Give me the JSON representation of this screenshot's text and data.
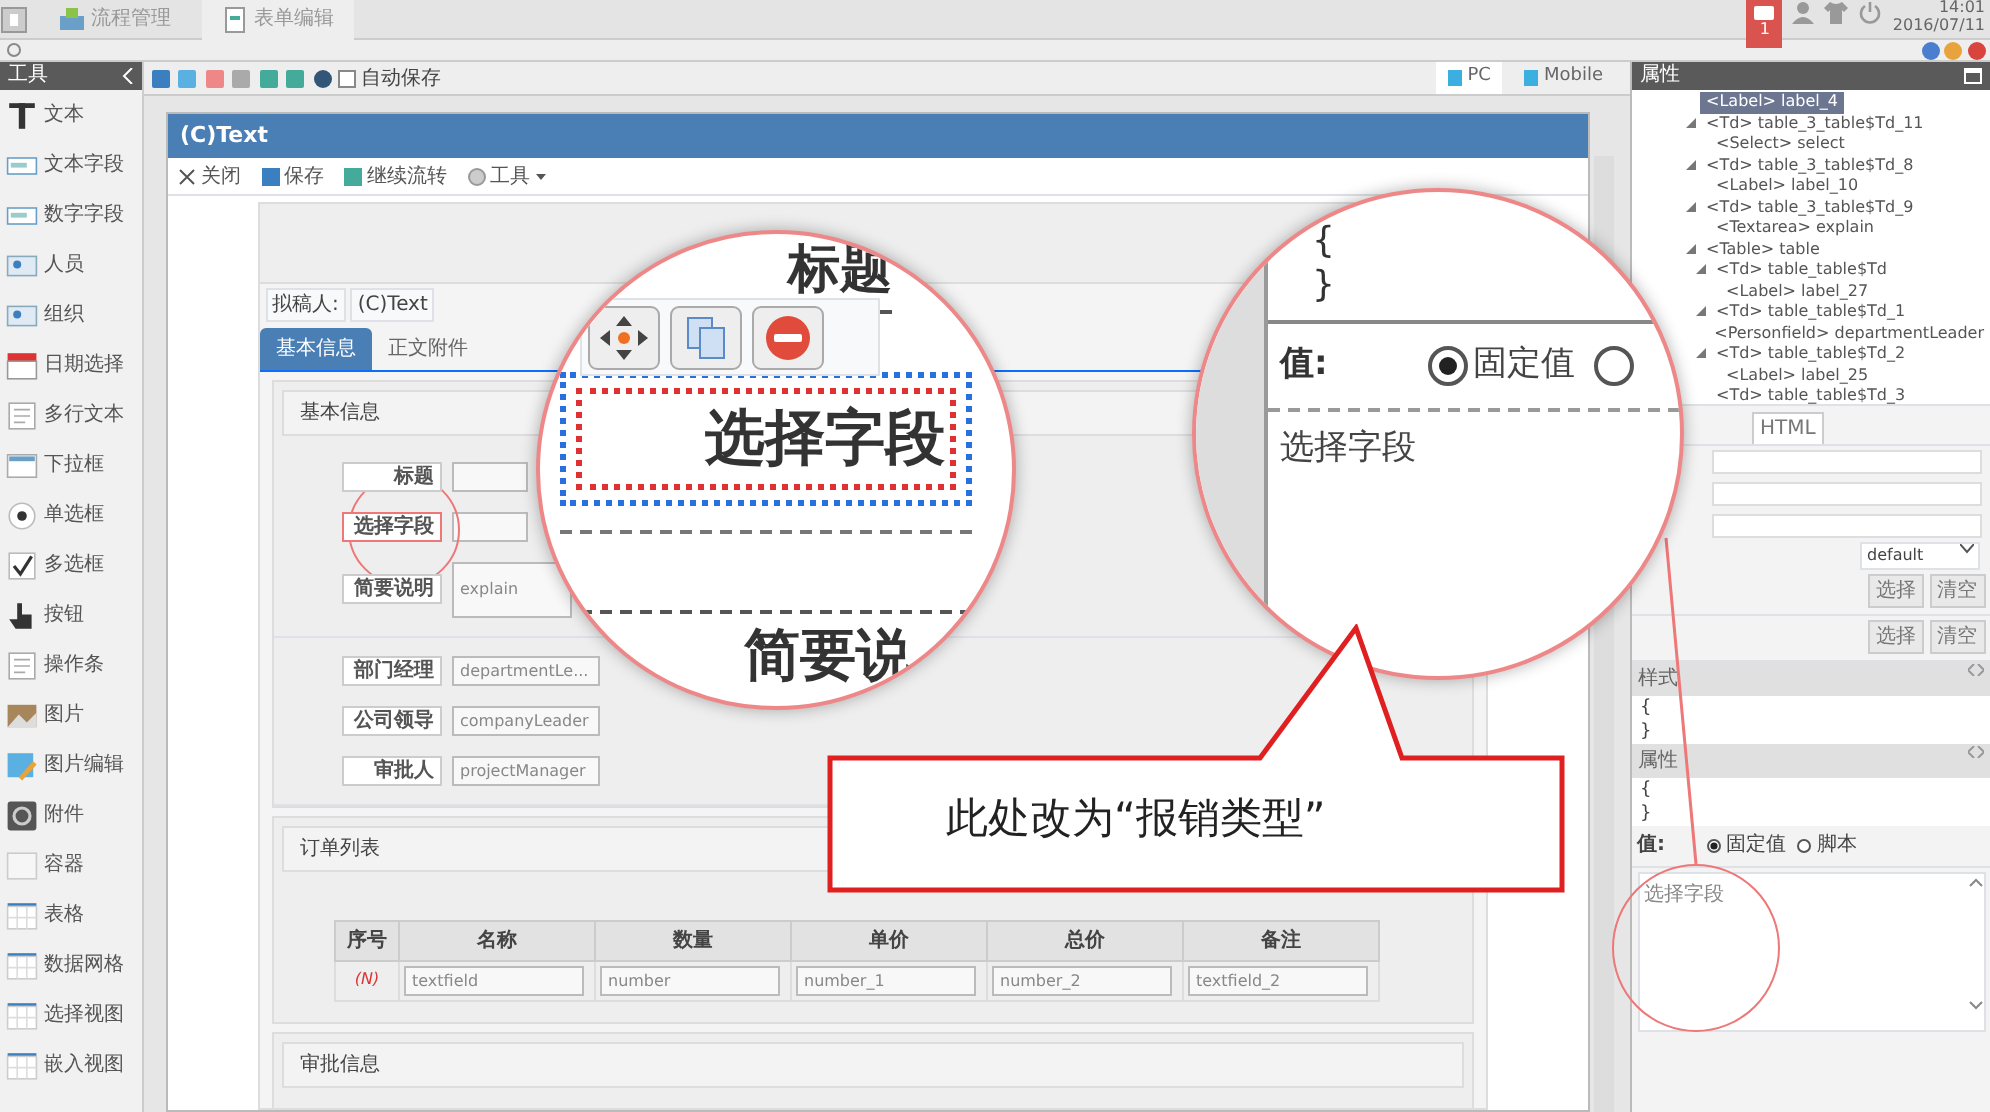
{
  "top_bar": {
    "tabs": [
      {
        "label": "流程管理",
        "selected": false
      },
      {
        "label": "表单编辑",
        "selected": true
      }
    ],
    "notification_count": "1",
    "time": "14:01",
    "date": "2016/07/11"
  },
  "toolbar": {
    "autosave": {
      "label": "自动保存",
      "checked": false
    },
    "view_modes": [
      {
        "label": "PC",
        "selected": true
      },
      {
        "label": "Mobile",
        "selected": false
      }
    ]
  },
  "tools_panel": {
    "title": "工具",
    "items": [
      {
        "label": "文本",
        "kind": "text"
      },
      {
        "label": "文本字段",
        "kind": "field"
      },
      {
        "label": "数字字段",
        "kind": "field"
      },
      {
        "label": "人员",
        "kind": "person"
      },
      {
        "label": "组织",
        "kind": "person"
      },
      {
        "label": "日期选择",
        "kind": "calendar"
      },
      {
        "label": "多行文本",
        "kind": "lines"
      },
      {
        "label": "下拉框",
        "kind": "dropdown"
      },
      {
        "label": "单选框",
        "kind": "radio"
      },
      {
        "label": "多选框",
        "kind": "check"
      },
      {
        "label": "按钮",
        "kind": "hand"
      },
      {
        "label": "操作条",
        "kind": "lines"
      },
      {
        "label": "图片",
        "kind": "image"
      },
      {
        "label": "图片编辑",
        "kind": "edit"
      },
      {
        "label": "附件",
        "kind": "clip"
      },
      {
        "label": "容器",
        "kind": "panel"
      },
      {
        "label": "表格",
        "kind": "grid"
      },
      {
        "label": "数据网格",
        "kind": "grid"
      },
      {
        "label": "选择视图",
        "kind": "grid"
      },
      {
        "label": "嵌入视图",
        "kind": "grid"
      }
    ]
  },
  "form_window": {
    "title": "(C)Text",
    "actions": [
      "关闭",
      "保存",
      "继续流转",
      "工具"
    ],
    "drafter": {
      "label": "拟稿人:",
      "value": "(C)Text"
    },
    "tabs": [
      {
        "label": "基本信息",
        "selected": true
      },
      {
        "label": "正文附件",
        "selected": false
      }
    ],
    "basic_section": {
      "title": "基本信息",
      "groups": [
        [
          {
            "label": "标题",
            "highlighted": false
          },
          {
            "label": "选择字段",
            "highlighted": true
          },
          {
            "label": "简要说明",
            "placeholder": "explain",
            "highlighted": false
          }
        ],
        [
          {
            "label": "部门经理",
            "placeholder": "departmentLe...",
            "highlighted": false
          },
          {
            "label": "公司领导",
            "placeholder": "companyLeader",
            "highlighted": false
          },
          {
            "label": "审批人",
            "placeholder": "projectManager",
            "highlighted": false
          }
        ]
      ]
    },
    "order_section": {
      "title": "订单列表",
      "columns": [
        "序号",
        "名称",
        "数量",
        "单价",
        "总价",
        "备注"
      ],
      "row_marker": "(N)",
      "row_fields": [
        {
          "placeholder": "textfield"
        },
        {
          "placeholder": "number"
        },
        {
          "placeholder": "number_1"
        },
        {
          "placeholder": "number_2"
        },
        {
          "placeholder": "textfield_2"
        }
      ]
    },
    "approval_section": {
      "title": "审批信息"
    }
  },
  "properties_panel": {
    "title": "属性",
    "tree": [
      {
        "label": "<Label> label_4",
        "selected": true,
        "expandable": false
      },
      {
        "label": "<Td> table_3_table$Td_11",
        "selected": false,
        "expandable": true,
        "children": [
          {
            "label": "<Select> select",
            "selected": false,
            "expandable": false
          }
        ]
      },
      {
        "label": "<Td> table_3_table$Td_8",
        "selected": false,
        "expandable": true,
        "children": [
          {
            "label": "<Label> label_10",
            "selected": false,
            "expandable": false
          }
        ]
      },
      {
        "label": "<Td> table_3_table$Td_9",
        "selected": false,
        "expandable": true,
        "children": [
          {
            "label": "<Textarea> explain",
            "selected": false,
            "expandable": false
          }
        ]
      },
      {
        "label": "<Table> table",
        "selected": false,
        "expandable": true,
        "children": [
          {
            "label": "<Td> table_table$Td",
            "selected": false,
            "expandable": true,
            "children": [
              {
                "label": "<Label> label_27",
                "selected": false,
                "expandable": false
              }
            ]
          },
          {
            "label": "<Td> table_table$Td_1",
            "selected": false,
            "expandable": true,
            "children": [
              {
                "label": "<Personfield> departmentLeader",
                "selected": false,
                "expandable": false
              }
            ]
          },
          {
            "label": "<Td> table_table$Td_2",
            "selected": false,
            "expandable": true,
            "children": [
              {
                "label": "<Label> label_25",
                "selected": false,
                "expandable": false
              }
            ]
          },
          {
            "label": "<Td> table_table$Td_3",
            "selected": false,
            "expandable": false
          }
        ]
      }
    ],
    "tab": "HTML",
    "select_value": "default",
    "button_rows": [
      [
        "选择",
        "清空"
      ],
      [
        "选择",
        "清空"
      ]
    ],
    "style_section": {
      "title": "样式",
      "lines": [
        "{",
        "}"
      ]
    },
    "attr_section": {
      "title": "属性",
      "lines": [
        "{",
        "}"
      ]
    },
    "value_label": "值:",
    "value_modes": [
      {
        "label": "固定值",
        "selected": true
      },
      {
        "label": "脚本",
        "selected": false
      }
    ],
    "value_text": "选择字段"
  },
  "zoom_left": {
    "top_label": "标题",
    "selected_label": "选择字段",
    "bottom_label": "简要说"
  },
  "zoom_right": {
    "lines": [
      "{",
      "}"
    ],
    "value_label": "值:",
    "value_modes": [
      {
        "label": "固定值",
        "selected": true
      },
      {
        "selected": false
      }
    ],
    "value_text": "选择字段"
  },
  "callout": {
    "text": "此处改为“报销类型”"
  }
}
